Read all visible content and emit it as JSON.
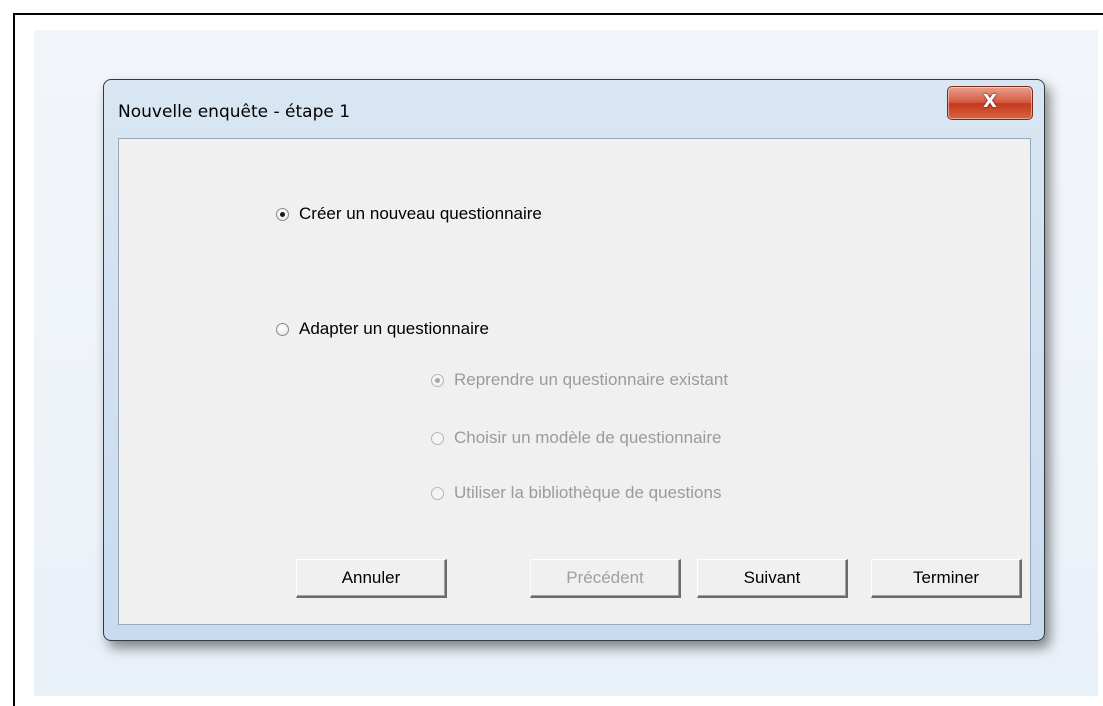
{
  "dialog": {
    "title": "Nouvelle enquête - étape 1",
    "close_glyph": "X"
  },
  "options": {
    "create_new": {
      "label": "Créer un nouveau questionnaire",
      "checked": true,
      "enabled": true
    },
    "adapt": {
      "label": "Adapter un questionnaire",
      "checked": false,
      "enabled": true
    },
    "sub_options": [
      {
        "label": "Reprendre un questionnaire existant",
        "checked": true,
        "enabled": false
      },
      {
        "label": "Choisir un modèle de questionnaire",
        "checked": false,
        "enabled": false
      },
      {
        "label": "Utiliser la bibliothèque de questions",
        "checked": false,
        "enabled": false
      }
    ]
  },
  "buttons": {
    "cancel": "Annuler",
    "previous": "Précédent",
    "next": "Suivant",
    "finish": "Terminer"
  },
  "colors": {
    "close_button": "#c6391f",
    "dialog_frame": "#c8dbef",
    "client_area": "#f0f0f0",
    "disabled_text": "#9b9b9b"
  },
  "icons": {
    "close": "close-icon",
    "radio": "radio-button"
  }
}
